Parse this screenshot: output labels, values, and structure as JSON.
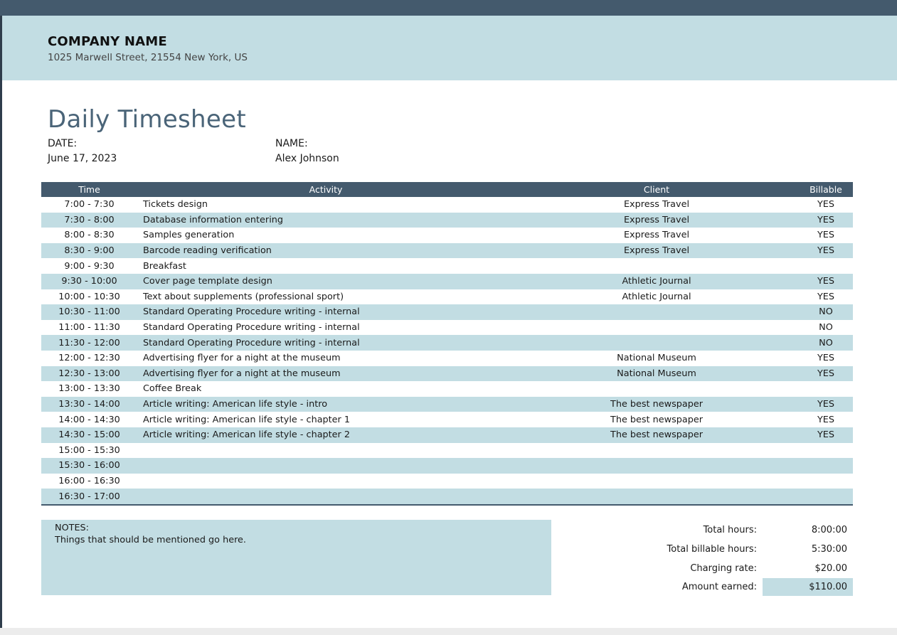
{
  "company": {
    "name": "COMPANY NAME",
    "address": "1025 Marwell Street, 21554 New York, US"
  },
  "title": "Daily Timesheet",
  "meta": {
    "date_label": "DATE:",
    "date_value": "June 17, 2023",
    "name_label": "NAME:",
    "name_value": "Alex Johnson"
  },
  "table": {
    "headers": [
      "Time",
      "Activity",
      "Client",
      "Billable"
    ],
    "rows": [
      {
        "time": "7:00 - 7:30",
        "activity": "Tickets design",
        "client": "Express Travel",
        "billable": "YES"
      },
      {
        "time": "7:30 - 8:00",
        "activity": "Database information entering",
        "client": "Express Travel",
        "billable": "YES"
      },
      {
        "time": "8:00 - 8:30",
        "activity": "Samples generation",
        "client": "Express Travel",
        "billable": "YES"
      },
      {
        "time": "8:30 - 9:00",
        "activity": "Barcode reading verification",
        "client": "Express Travel",
        "billable": "YES"
      },
      {
        "time": "9:00 - 9:30",
        "activity": "Breakfast",
        "client": "",
        "billable": ""
      },
      {
        "time": "9:30 - 10:00",
        "activity": "Cover page template design",
        "client": "Athletic Journal",
        "billable": "YES"
      },
      {
        "time": "10:00 - 10:30",
        "activity": "Text about supplements (professional sport)",
        "client": "Athletic Journal",
        "billable": "YES"
      },
      {
        "time": "10:30 - 11:00",
        "activity": "Standard Operating Procedure writing - internal",
        "client": "",
        "billable": "NO"
      },
      {
        "time": "11:00 - 11:30",
        "activity": "Standard Operating Procedure writing - internal",
        "client": "",
        "billable": "NO"
      },
      {
        "time": "11:30 - 12:00",
        "activity": "Standard Operating Procedure writing - internal",
        "client": "",
        "billable": "NO"
      },
      {
        "time": "12:00 - 12:30",
        "activity": "Advertising flyer for a night at the museum",
        "client": "National Museum",
        "billable": "YES"
      },
      {
        "time": "12:30 - 13:00",
        "activity": "Advertising flyer for a night at the museum",
        "client": "National Museum",
        "billable": "YES"
      },
      {
        "time": "13:00 - 13:30",
        "activity": "Coffee Break",
        "client": "",
        "billable": ""
      },
      {
        "time": "13:30 - 14:00",
        "activity": "Article writing: American life style - intro",
        "client": "The best newspaper",
        "billable": "YES"
      },
      {
        "time": "14:00 - 14:30",
        "activity": "Article writing: American life style - chapter 1",
        "client": "The best newspaper",
        "billable": "YES"
      },
      {
        "time": "14:30 - 15:00",
        "activity": "Article writing: American life style - chapter 2",
        "client": "The best newspaper",
        "billable": "YES"
      },
      {
        "time": "15:00 - 15:30",
        "activity": "",
        "client": "",
        "billable": ""
      },
      {
        "time": "15:30 - 16:00",
        "activity": "",
        "client": "",
        "billable": ""
      },
      {
        "time": "16:00 - 16:30",
        "activity": "",
        "client": "",
        "billable": ""
      },
      {
        "time": "16:30 - 17:00",
        "activity": "",
        "client": "",
        "billable": ""
      }
    ]
  },
  "notes": {
    "label": "NOTES:",
    "text": "Things that should be mentioned go here."
  },
  "summary": {
    "total_hours_label": "Total hours:",
    "total_hours_value": "8:00:00",
    "billable_hours_label": "Total billable hours:",
    "billable_hours_value": "5:30:00",
    "rate_label": "Charging rate:",
    "rate_value": "$20.00",
    "earned_label": "Amount earned:",
    "earned_value": "$110.00"
  },
  "colors": {
    "header_dark": "#445a6d",
    "band_light": "#c2dde3",
    "title": "#4a6478"
  }
}
